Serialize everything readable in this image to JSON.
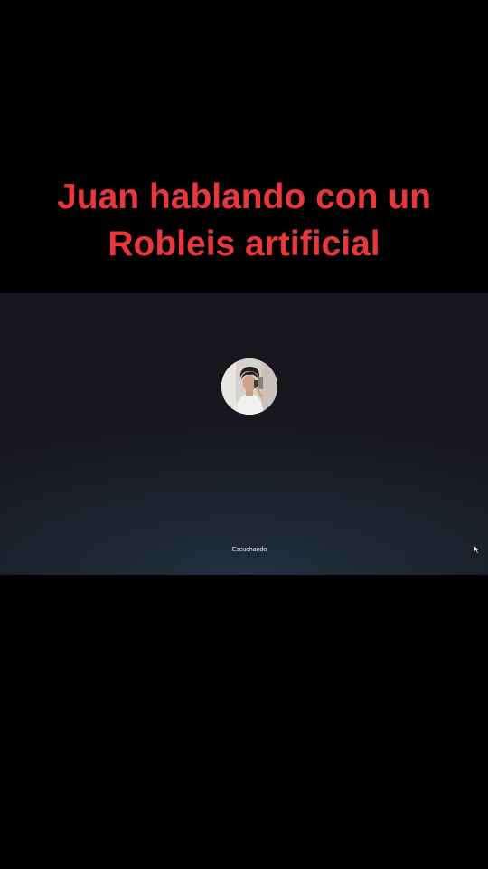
{
  "overlay": {
    "line1": "Juan hablando con un",
    "line2": "Robleis artificial",
    "color": "#e8383c"
  },
  "assistant": {
    "status_text": "Escuchando",
    "avatar_icon": "user-photo-avatar",
    "background_color": "#17191f"
  },
  "cursor": {
    "icon": "mouse-pointer-icon"
  }
}
